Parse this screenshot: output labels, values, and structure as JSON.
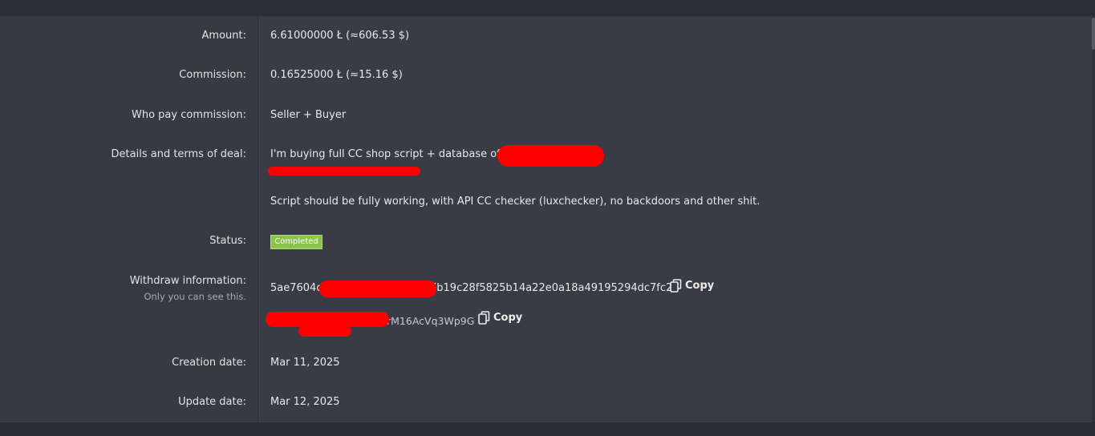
{
  "rows": {
    "amount": {
      "label": "Amount:",
      "value": "6.61000000 Ł (≈606.53 $)"
    },
    "commission": {
      "label": "Commission:",
      "value": "0.16525000 Ł (≈15.16 $)"
    },
    "who_pays": {
      "label": "Who pay commission:",
      "value": "Seller + Buyer"
    },
    "details": {
      "label": "Details and terms of deal:",
      "line1": "I'm buying full CC shop script + database of h",
      "line2": "Script should be fully working, with API CC checker (luxchecker), no backdoors and other shit."
    },
    "status": {
      "label": "Status:",
      "badge": "Completed"
    },
    "withdraw": {
      "label": "Withdraw information:",
      "sub": "Only you can see this.",
      "hash_prefix": "5ae7604dd",
      "hash_suffix": "7b19c28f5825b14a22e0a18a49195294dc7fc2",
      "address_suffix": "rM16AcVq3Wp9G",
      "copy_label": "Copy"
    },
    "created": {
      "label": "Creation date:",
      "value": "Mar 11, 2025"
    },
    "updated": {
      "label": "Update date:",
      "value": "Mar 12, 2025"
    }
  },
  "colors": {
    "status_badge": "#8bc34a",
    "redaction": "#ff0000",
    "panel_bg": "#393c44"
  }
}
